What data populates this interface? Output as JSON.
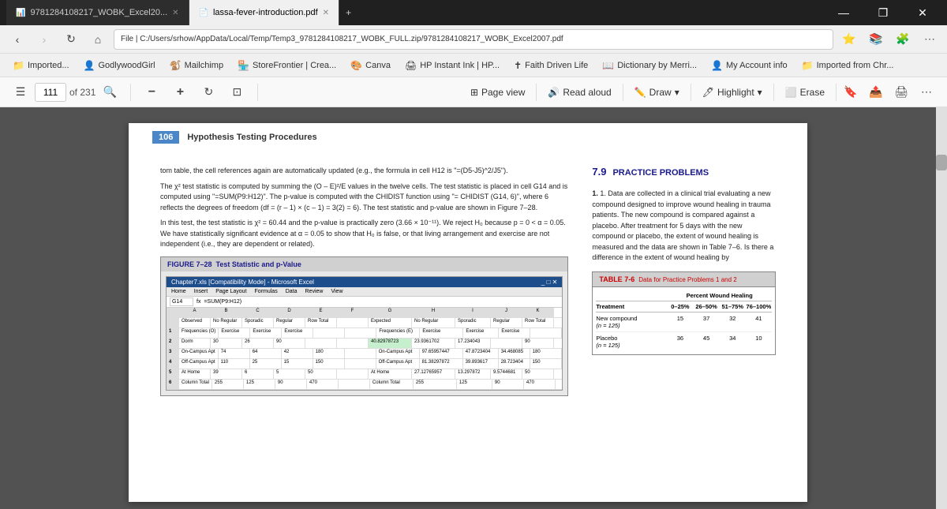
{
  "titlebar": {
    "tabs": [
      {
        "id": "tab-excel",
        "label": "9781284108217_WOBK_Excel20...",
        "icon": "📊",
        "active": false
      },
      {
        "id": "tab-pdf",
        "label": "lassa-fever-introduction.pdf",
        "icon": "📄",
        "active": true
      }
    ],
    "add_tab_label": "+",
    "controls": [
      "—",
      "❐",
      "✕"
    ]
  },
  "addressbar": {
    "back_disabled": false,
    "forward_disabled": true,
    "url": "File  |  C:/Users/srhow/AppData/Local/Temp/Temp3_9781284108217_WOBK_FULL.zip/9781284108217_WOBK_Excel2007.pdf",
    "icons": [
      "⭐",
      "↻",
      "🔒"
    ]
  },
  "favbar": {
    "items": [
      {
        "label": "Imported...",
        "icon": "📁"
      },
      {
        "label": "GodlywoodGirl",
        "icon": "👤"
      },
      {
        "label": "Mailchimp",
        "icon": "🐒"
      },
      {
        "label": "StoreFrontier | Crea...",
        "icon": "🏪"
      },
      {
        "label": "Canva",
        "icon": "🎨"
      },
      {
        "label": "HP Instant Ink | HP...",
        "icon": "🖨"
      },
      {
        "label": "Faith Driven Life",
        "icon": "✝"
      },
      {
        "label": "Dictionary by Merri...",
        "icon": "📖"
      },
      {
        "label": "My Account info",
        "icon": "👤"
      },
      {
        "label": "Imported from Chr...",
        "icon": "📁"
      }
    ]
  },
  "pdf_toolbar": {
    "menu_icon": "☰",
    "page_current": "111",
    "page_total": "of 231",
    "search_icon": "🔍",
    "zoom_out": "—",
    "zoom_in": "+",
    "rotate": "↻",
    "fit": "⊡",
    "page_view_label": "Page view",
    "read_aloud_label": "Read aloud",
    "draw_label": "Draw",
    "highlight_label": "Highlight",
    "erase_label": "Erase",
    "actions_right": [
      "🔖",
      "📤",
      "🖨",
      "🏷"
    ]
  },
  "pdf_page": {
    "page_number": "106",
    "chapter_label": "Hypothesis Testing Procedures",
    "left_column": {
      "paragraphs": [
        "tom table, the cell references again are automatically updated (e.g., the formula in cell H12 is \"=(D5-J5)^2/J5\").",
        "The χ² test statistic is computed by summing the (O – E)²/E values in the twelve cells. The test statistic is placed in cell G14 and is computed using \"=SUM(P9:H12)\". The p-value is computed with the CHIDIST function using \"= CHIDIST (G14, 6)\", where 6 reflects the degrees of freedom (df = (r – 1) × (c – 1) = 3(2) = 6). The test statistic and p-value are shown in Figure 7–28.",
        "In this test, the test statistic is χ² = 60.44 and the p-value is practically zero (3.66 × 10⁻¹¹). We reject H₀ because p = 0 < α = 0.05. We have statistically significant evidence at α = 0.05 to show that H₀ is false, or that living arrangement and exercise are not independent (i.e., they are dependent or related)."
      ]
    },
    "right_column": {
      "section_num": "7.9",
      "section_title": "PRACTICE PROBLEMS",
      "problem_1": "1. Data are collected in a clinical trial evaluating a new compound designed to improve wound healing in trauma patients. The new compound is compared against a placebo. After treatment for 5 days with the new compound or placebo, the extent of wound healing is measured and the data are shown in Table 7–6. Is there a difference in the extent of wound healing by"
    },
    "table": {
      "title": "TABLE 7-6",
      "subtitle": "Data for Practice Problems 1 and 2",
      "col_headers": [
        "Treatment",
        "0–25%",
        "26–50%",
        "51–75%",
        "76–100%"
      ],
      "pct_wound_label": "Percent Wound Healing",
      "rows": [
        {
          "treatment": "New compound",
          "n": "(n = 125)",
          "vals": [
            "15",
            "37",
            "32",
            "41"
          ]
        },
        {
          "treatment": "Placebo",
          "n": "(n = 125)",
          "vals": [
            "36",
            "45",
            "34",
            "10"
          ]
        }
      ]
    },
    "figure": {
      "label": "FIGURE 7–28",
      "title": "Test Statistic and p-Value",
      "excel": {
        "title": "Chapter7.xls [Compatibility Mode] - Microsoft Excel",
        "formula_cell": "G14",
        "formula": "=SUM(P9:H12)",
        "ribbon_tabs": [
          "Home",
          "Insert",
          "Page Layout",
          "Formulas",
          "Data",
          "Review",
          "View"
        ],
        "col_headers": [
          "",
          "A",
          "B",
          "C",
          "D",
          "E",
          "F",
          "G",
          "H",
          "I",
          "J",
          "K"
        ],
        "rows": [
          {
            "label": "",
            "cells": [
              "",
              "Observed",
              "No Regular",
              "Sporadic",
              "Regular",
              "Row Total",
              "",
              "Expected",
              "No Regular",
              "Sporadic",
              "Regular",
              "Row Total"
            ]
          },
          {
            "label": "1",
            "cells": [
              "1",
              "Frequencies (O)",
              "Exercise",
              "Exercise",
              "Exercise",
              "",
              "",
              "Frequencies (E)",
              "Exercise",
              "Exercise",
              "Exercise",
              ""
            ]
          },
          {
            "label": "2",
            "cells": [
              "2",
              "Dorm",
              "30",
              "26",
              "90",
              "",
              "",
              "40.82978723",
              "23.9361702",
              "17.234043",
              "",
              "90"
            ]
          },
          {
            "label": "3",
            "cells": [
              "3",
              "On-Campus Apt",
              "74",
              "64",
              "42",
              "180",
              "",
              "On-Campus Apt",
              "97.65957447",
              "47.8723404",
              "34.468085",
              "180"
            ]
          },
          {
            "label": "4",
            "cells": [
              "4",
              "Off-Campus Apt",
              "110",
              "25",
              "15",
              "150",
              "",
              "Off-Campus Apt",
              "81.38297872",
              "39.893617",
              "28.723404",
              "150"
            ]
          },
          {
            "label": "5",
            "cells": [
              "5",
              "At Home",
              "39",
              "6",
              "5",
              "50",
              "",
              "At Home",
              "27.12765957",
              "13.297872",
              "9.5744681",
              "50"
            ]
          },
          {
            "label": "6",
            "cells": [
              "6",
              "Column Total",
              "253",
              "125",
              "90",
              "470",
              "",
              "Column Total",
              "253",
              "125",
              "90",
              "470"
            ]
          }
        ]
      }
    }
  }
}
